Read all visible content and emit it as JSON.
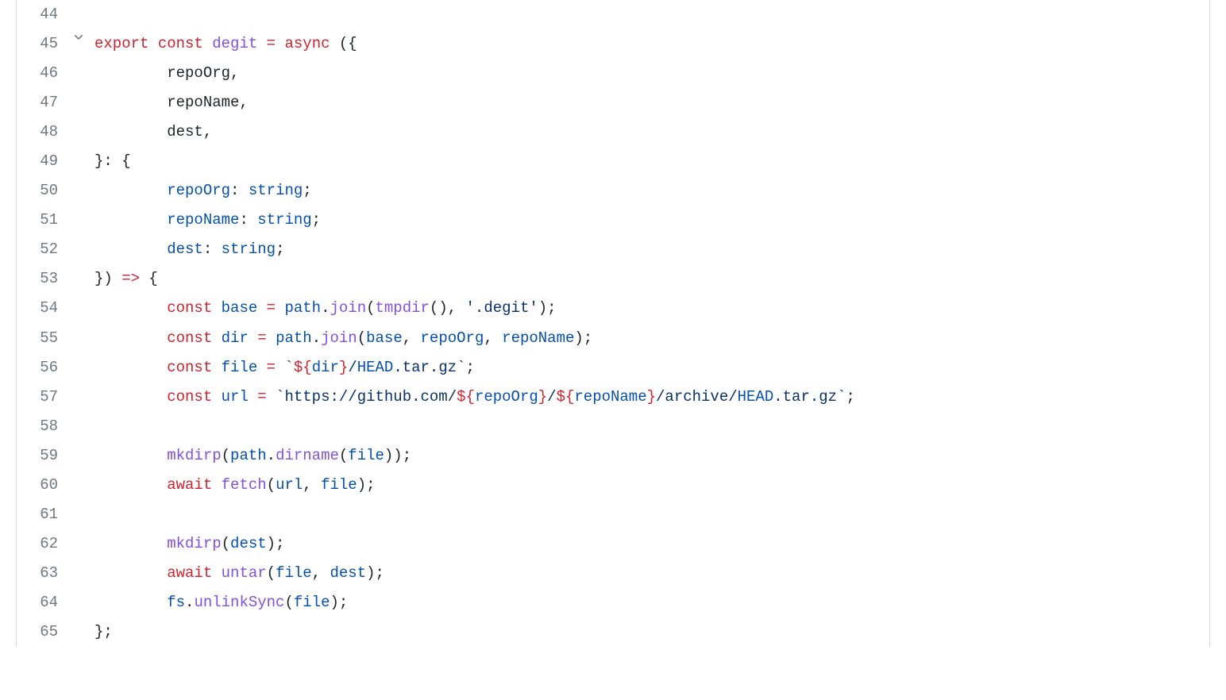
{
  "lines": [
    {
      "n": "44",
      "fold": false,
      "tokens": []
    },
    {
      "n": "45",
      "fold": true,
      "tokens": [
        {
          "c": "kw-red",
          "t": "export"
        },
        {
          "c": "plain",
          "t": " "
        },
        {
          "c": "kw-red",
          "t": "const"
        },
        {
          "c": "plain",
          "t": " "
        },
        {
          "c": "kw-purple",
          "t": "degit"
        },
        {
          "c": "plain",
          "t": " "
        },
        {
          "c": "kw-red",
          "t": "="
        },
        {
          "c": "plain",
          "t": " "
        },
        {
          "c": "kw-red",
          "t": "async"
        },
        {
          "c": "plain",
          "t": " ({"
        }
      ]
    },
    {
      "n": "46",
      "fold": false,
      "tokens": [
        {
          "c": "plain",
          "t": "        repoOrg,"
        }
      ]
    },
    {
      "n": "47",
      "fold": false,
      "tokens": [
        {
          "c": "plain",
          "t": "        repoName,"
        }
      ]
    },
    {
      "n": "48",
      "fold": false,
      "tokens": [
        {
          "c": "plain",
          "t": "        dest,"
        }
      ]
    },
    {
      "n": "49",
      "fold": false,
      "tokens": [
        {
          "c": "plain",
          "t": "}: {"
        }
      ]
    },
    {
      "n": "50",
      "fold": false,
      "tokens": [
        {
          "c": "plain",
          "t": "        "
        },
        {
          "c": "kw-blue",
          "t": "repoOrg"
        },
        {
          "c": "plain",
          "t": ": "
        },
        {
          "c": "kw-blue",
          "t": "string"
        },
        {
          "c": "plain",
          "t": ";"
        }
      ]
    },
    {
      "n": "51",
      "fold": false,
      "tokens": [
        {
          "c": "plain",
          "t": "        "
        },
        {
          "c": "kw-blue",
          "t": "repoName"
        },
        {
          "c": "plain",
          "t": ": "
        },
        {
          "c": "kw-blue",
          "t": "string"
        },
        {
          "c": "plain",
          "t": ";"
        }
      ]
    },
    {
      "n": "52",
      "fold": false,
      "tokens": [
        {
          "c": "plain",
          "t": "        "
        },
        {
          "c": "kw-blue",
          "t": "dest"
        },
        {
          "c": "plain",
          "t": ": "
        },
        {
          "c": "kw-blue",
          "t": "string"
        },
        {
          "c": "plain",
          "t": ";"
        }
      ]
    },
    {
      "n": "53",
      "fold": false,
      "tokens": [
        {
          "c": "plain",
          "t": "}) "
        },
        {
          "c": "kw-red",
          "t": "=>"
        },
        {
          "c": "plain",
          "t": " {"
        }
      ]
    },
    {
      "n": "54",
      "fold": false,
      "tokens": [
        {
          "c": "plain",
          "t": "        "
        },
        {
          "c": "kw-red",
          "t": "const"
        },
        {
          "c": "plain",
          "t": " "
        },
        {
          "c": "kw-blue",
          "t": "base"
        },
        {
          "c": "plain",
          "t": " "
        },
        {
          "c": "kw-red",
          "t": "="
        },
        {
          "c": "plain",
          "t": " "
        },
        {
          "c": "kw-blue",
          "t": "path"
        },
        {
          "c": "plain",
          "t": "."
        },
        {
          "c": "kw-purple",
          "t": "join"
        },
        {
          "c": "plain",
          "t": "("
        },
        {
          "c": "kw-purple",
          "t": "tmpdir"
        },
        {
          "c": "plain",
          "t": "(), "
        },
        {
          "c": "str-blue",
          "t": "'.degit'"
        },
        {
          "c": "plain",
          "t": ");"
        }
      ]
    },
    {
      "n": "55",
      "fold": false,
      "tokens": [
        {
          "c": "plain",
          "t": "        "
        },
        {
          "c": "kw-red",
          "t": "const"
        },
        {
          "c": "plain",
          "t": " "
        },
        {
          "c": "kw-blue",
          "t": "dir"
        },
        {
          "c": "plain",
          "t": " "
        },
        {
          "c": "kw-red",
          "t": "="
        },
        {
          "c": "plain",
          "t": " "
        },
        {
          "c": "kw-blue",
          "t": "path"
        },
        {
          "c": "plain",
          "t": "."
        },
        {
          "c": "kw-purple",
          "t": "join"
        },
        {
          "c": "plain",
          "t": "("
        },
        {
          "c": "kw-blue",
          "t": "base"
        },
        {
          "c": "plain",
          "t": ", "
        },
        {
          "c": "kw-blue",
          "t": "repoOrg"
        },
        {
          "c": "plain",
          "t": ", "
        },
        {
          "c": "kw-blue",
          "t": "repoName"
        },
        {
          "c": "plain",
          "t": ");"
        }
      ]
    },
    {
      "n": "56",
      "fold": false,
      "tokens": [
        {
          "c": "plain",
          "t": "        "
        },
        {
          "c": "kw-red",
          "t": "const"
        },
        {
          "c": "plain",
          "t": " "
        },
        {
          "c": "kw-blue",
          "t": "file"
        },
        {
          "c": "plain",
          "t": " "
        },
        {
          "c": "kw-red",
          "t": "="
        },
        {
          "c": "plain",
          "t": " "
        },
        {
          "c": "str-blue",
          "t": "`"
        },
        {
          "c": "kw-red",
          "t": "${"
        },
        {
          "c": "kw-blue",
          "t": "dir"
        },
        {
          "c": "kw-red",
          "t": "}"
        },
        {
          "c": "str-blue",
          "t": "/"
        },
        {
          "c": "kw-blue",
          "t": "HEAD"
        },
        {
          "c": "str-blue",
          "t": ".tar.gz`"
        },
        {
          "c": "plain",
          "t": ";"
        }
      ]
    },
    {
      "n": "57",
      "fold": false,
      "tokens": [
        {
          "c": "plain",
          "t": "        "
        },
        {
          "c": "kw-red",
          "t": "const"
        },
        {
          "c": "plain",
          "t": " "
        },
        {
          "c": "kw-blue",
          "t": "url"
        },
        {
          "c": "plain",
          "t": " "
        },
        {
          "c": "kw-red",
          "t": "="
        },
        {
          "c": "plain",
          "t": " "
        },
        {
          "c": "str-blue",
          "t": "`https://github.com/"
        },
        {
          "c": "kw-red",
          "t": "${"
        },
        {
          "c": "kw-blue",
          "t": "repoOrg"
        },
        {
          "c": "kw-red",
          "t": "}"
        },
        {
          "c": "str-blue",
          "t": "/"
        },
        {
          "c": "kw-red",
          "t": "${"
        },
        {
          "c": "kw-blue",
          "t": "repoName"
        },
        {
          "c": "kw-red",
          "t": "}"
        },
        {
          "c": "str-blue",
          "t": "/archive/"
        },
        {
          "c": "kw-blue",
          "t": "HEAD"
        },
        {
          "c": "str-blue",
          "t": ".tar.gz`"
        },
        {
          "c": "plain",
          "t": ";"
        }
      ]
    },
    {
      "n": "58",
      "fold": false,
      "tokens": []
    },
    {
      "n": "59",
      "fold": false,
      "tokens": [
        {
          "c": "plain",
          "t": "        "
        },
        {
          "c": "kw-purple",
          "t": "mkdirp"
        },
        {
          "c": "plain",
          "t": "("
        },
        {
          "c": "kw-blue",
          "t": "path"
        },
        {
          "c": "plain",
          "t": "."
        },
        {
          "c": "kw-purple",
          "t": "dirname"
        },
        {
          "c": "plain",
          "t": "("
        },
        {
          "c": "kw-blue",
          "t": "file"
        },
        {
          "c": "plain",
          "t": "));"
        }
      ]
    },
    {
      "n": "60",
      "fold": false,
      "tokens": [
        {
          "c": "plain",
          "t": "        "
        },
        {
          "c": "kw-red",
          "t": "await"
        },
        {
          "c": "plain",
          "t": " "
        },
        {
          "c": "kw-purple",
          "t": "fetch"
        },
        {
          "c": "plain",
          "t": "("
        },
        {
          "c": "kw-blue",
          "t": "url"
        },
        {
          "c": "plain",
          "t": ", "
        },
        {
          "c": "kw-blue",
          "t": "file"
        },
        {
          "c": "plain",
          "t": ");"
        }
      ]
    },
    {
      "n": "61",
      "fold": false,
      "tokens": []
    },
    {
      "n": "62",
      "fold": false,
      "tokens": [
        {
          "c": "plain",
          "t": "        "
        },
        {
          "c": "kw-purple",
          "t": "mkdirp"
        },
        {
          "c": "plain",
          "t": "("
        },
        {
          "c": "kw-blue",
          "t": "dest"
        },
        {
          "c": "plain",
          "t": ");"
        }
      ]
    },
    {
      "n": "63",
      "fold": false,
      "tokens": [
        {
          "c": "plain",
          "t": "        "
        },
        {
          "c": "kw-red",
          "t": "await"
        },
        {
          "c": "plain",
          "t": " "
        },
        {
          "c": "kw-purple",
          "t": "untar"
        },
        {
          "c": "plain",
          "t": "("
        },
        {
          "c": "kw-blue",
          "t": "file"
        },
        {
          "c": "plain",
          "t": ", "
        },
        {
          "c": "kw-blue",
          "t": "dest"
        },
        {
          "c": "plain",
          "t": ");"
        }
      ]
    },
    {
      "n": "64",
      "fold": false,
      "tokens": [
        {
          "c": "plain",
          "t": "        "
        },
        {
          "c": "kw-blue",
          "t": "fs"
        },
        {
          "c": "plain",
          "t": "."
        },
        {
          "c": "kw-purple",
          "t": "unlinkSync"
        },
        {
          "c": "plain",
          "t": "("
        },
        {
          "c": "kw-blue",
          "t": "file"
        },
        {
          "c": "plain",
          "t": ");"
        }
      ]
    },
    {
      "n": "65",
      "fold": false,
      "tokens": [
        {
          "c": "plain",
          "t": "};"
        }
      ]
    }
  ]
}
